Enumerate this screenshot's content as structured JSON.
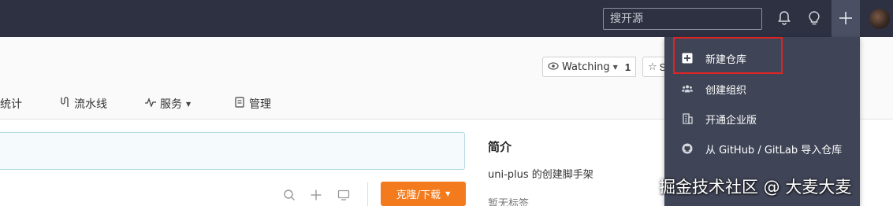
{
  "topbar": {
    "search_placeholder": "搜开源",
    "icons": [
      "bell-icon",
      "lightbulb-icon",
      "plus-icon",
      "avatar"
    ],
    "background": "#2d3142"
  },
  "repo": {
    "watch_label": "Watching",
    "watch_count": "1",
    "star_label": "S"
  },
  "tabs": [
    {
      "label": "统计",
      "icon": "chart-icon"
    },
    {
      "label": "流水线",
      "icon": "pipeline-icon"
    },
    {
      "label": "服务",
      "icon": "pulse-icon"
    },
    {
      "label": "管理",
      "icon": "settings-doc-icon"
    }
  ],
  "main": {
    "clone_label": "克隆/下载",
    "clone_color": "#f37b1d"
  },
  "sidebar": {
    "title": "简介",
    "description": "uni-plus 的创建脚手架",
    "tags": "暂无标签"
  },
  "menu": {
    "items": [
      {
        "label": "新建仓库",
        "icon": "plus-square-icon"
      },
      {
        "label": "创建组织",
        "icon": "users-icon"
      },
      {
        "label": "开通企业版",
        "icon": "building-icon"
      },
      {
        "label": "从 GitHub / GitLab 导入仓库",
        "icon": "github-icon"
      },
      {
        "label": "...",
        "icon": "import-icon"
      }
    ],
    "highlight_color": "#e02424"
  },
  "watermark": "掘金技术社区 @ 大麦大麦"
}
